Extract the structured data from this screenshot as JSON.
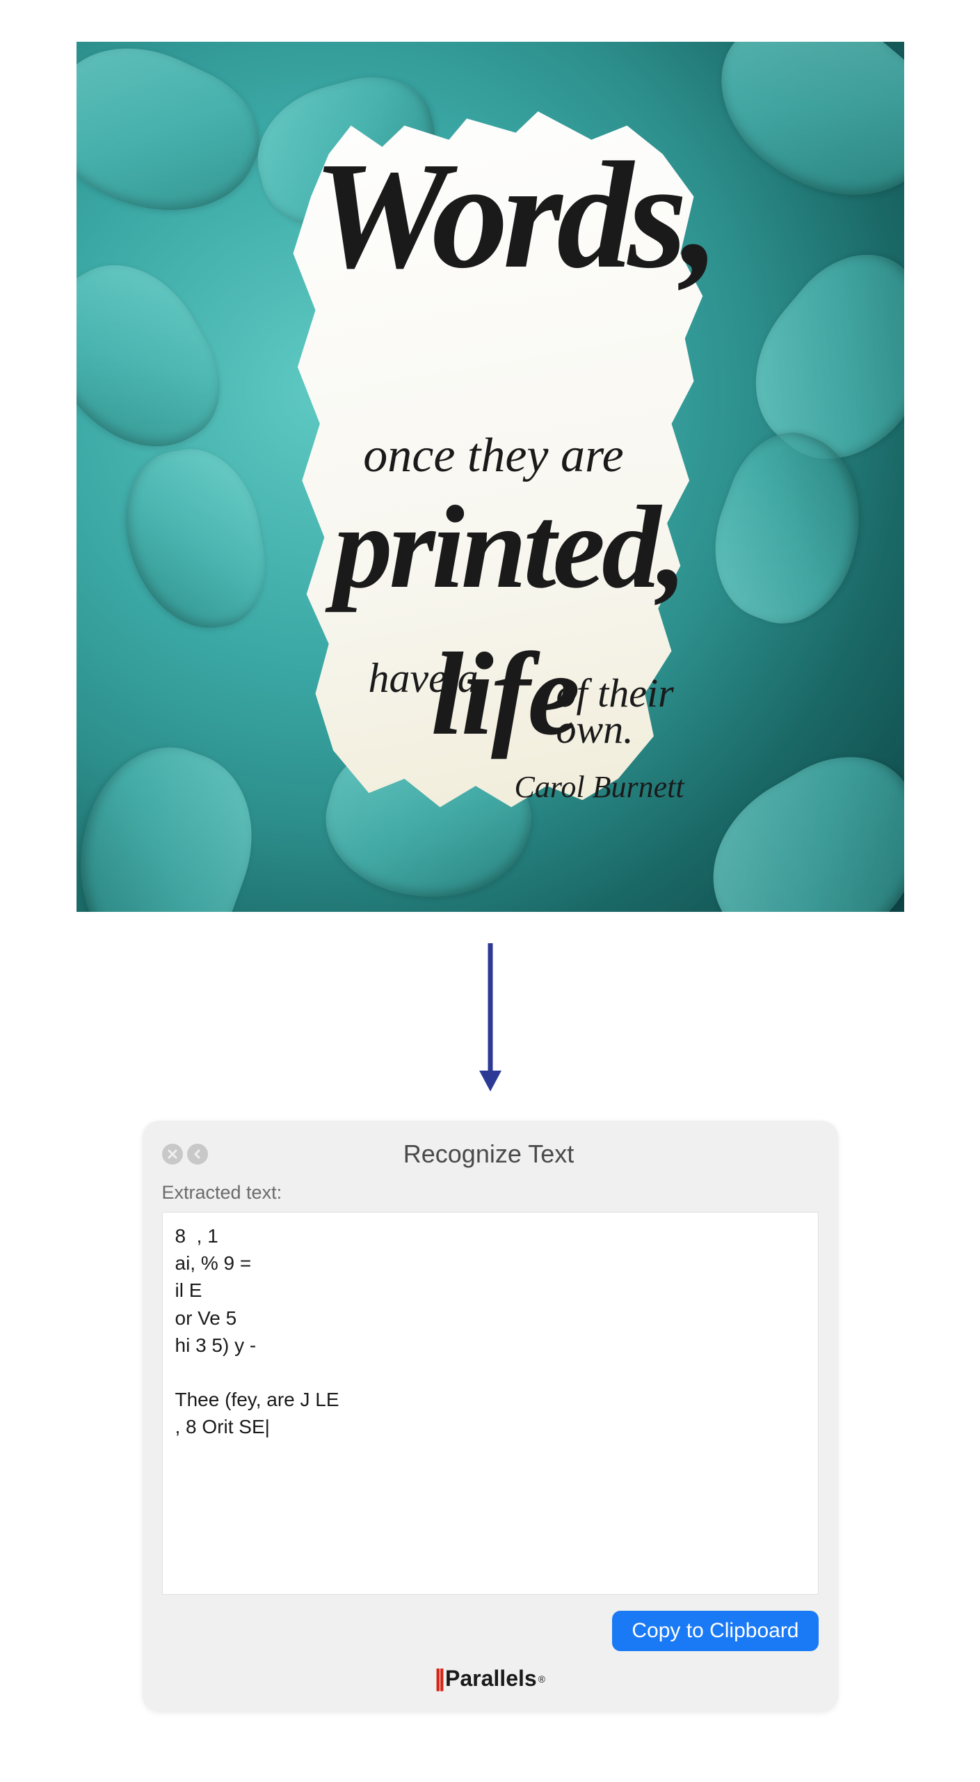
{
  "photo": {
    "quote": {
      "line1": "Words,",
      "line2": "once they are",
      "line3": "printed,",
      "line4a": "have a",
      "line4b": "life",
      "line4c_1": "of their",
      "line4c_2": "own.",
      "attribution": "Carol Burnett"
    }
  },
  "arrow": {
    "color": "#2c3a96"
  },
  "dialog": {
    "title": "Recognize Text",
    "extracted_label": "Extracted text:",
    "output_text": "8  , 1\nai, % 9 =\nil E\nor Ve 5\nhi 3 5) y -\n\nThee (fey, are J LE\n, 8 Orit SE|",
    "copy_button": "Copy to Clipboard",
    "close_icon": "close",
    "back_icon": "back"
  },
  "brand": {
    "bars": "||",
    "name": "Parallels",
    "reg": "®"
  }
}
